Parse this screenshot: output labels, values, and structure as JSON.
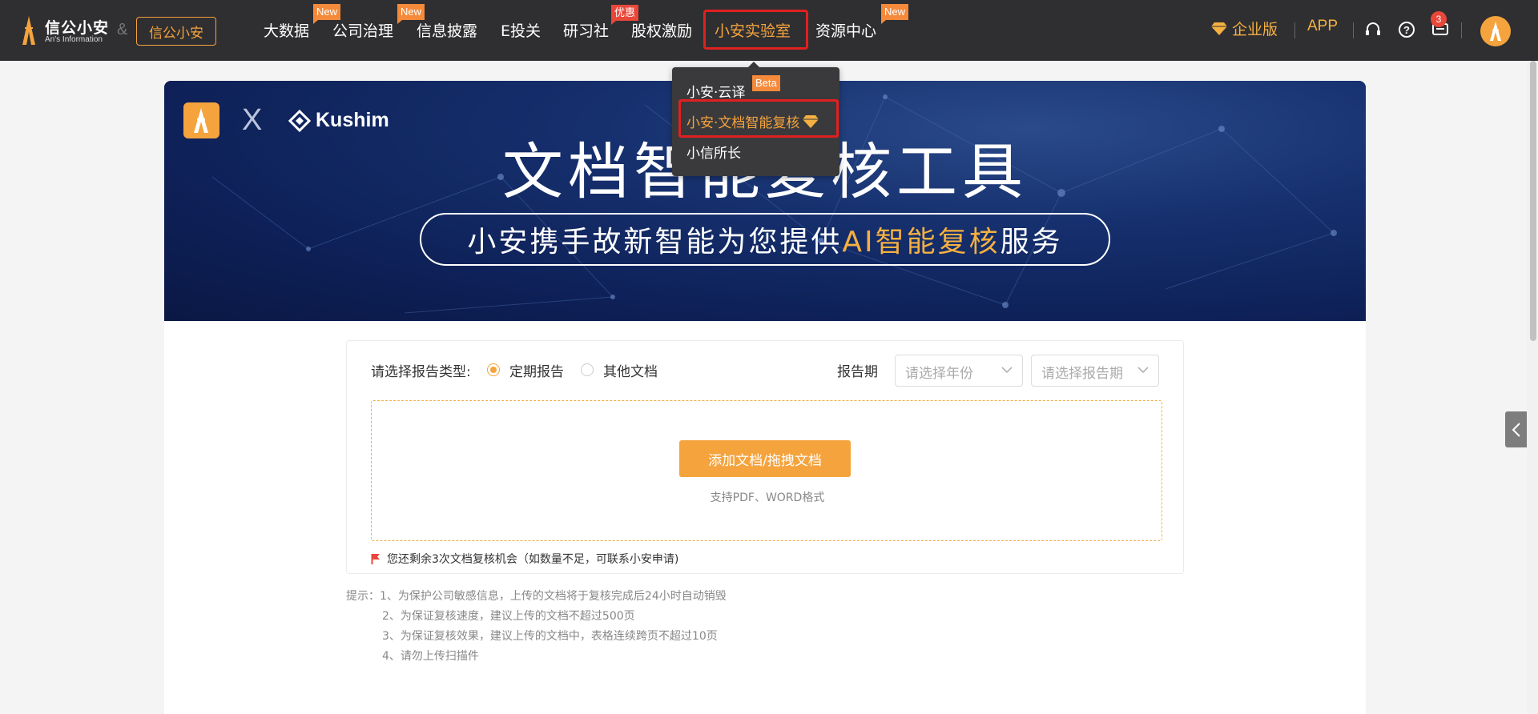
{
  "header": {
    "logo_name": "信公小安",
    "logo_en": "An's Information",
    "amp": "&",
    "partner_label": "信公小安",
    "nav": [
      {
        "label": "大数据",
        "badge": "New"
      },
      {
        "label": "公司治理",
        "badge": "New"
      },
      {
        "label": "信息披露",
        "badge": ""
      },
      {
        "label": "E投关",
        "badge": ""
      },
      {
        "label": "研习社",
        "badge": "优惠"
      },
      {
        "label": "股权激励",
        "badge": ""
      },
      {
        "label": "小安实验室",
        "badge": ""
      },
      {
        "label": "资源中心",
        "badge": "New"
      }
    ],
    "enterprise_label": "企业版",
    "app_label": "APP",
    "notice_count": "3",
    "colors": {
      "accent": "#f5a33d",
      "bar": "#2f2f31",
      "highlight": "#e02020"
    }
  },
  "dropdown": {
    "items": [
      {
        "label": "小安·云译",
        "badge": "Beta"
      },
      {
        "label": "小安·文档智能复核",
        "badge": ""
      },
      {
        "label": "小信所长",
        "badge": ""
      }
    ]
  },
  "banner": {
    "x_label": "X",
    "partner_name": "Kushim",
    "title": "文档智能复核工具",
    "subtitle_pre": "小安携手故新智能为您提供",
    "subtitle_hl": "AI智能复核",
    "subtitle_post": "服务"
  },
  "form": {
    "type_label": "请选择报告类型:",
    "options": [
      "定期报告",
      "其他文档"
    ],
    "selected": "定期报告",
    "period_label": "报告期",
    "year_placeholder": "请选择年份",
    "period_placeholder": "请选择报告期",
    "add_button": "添加文档/拖拽文档",
    "support_text": "支持PDF、WORD格式",
    "remain_text": "您还剩余3次文档复核机会（如数量不足，可联系小安申请)"
  },
  "tips": [
    "提示：1、为保护公司敏感信息，上传的文档将于复核完成后24小时自动销毁",
    "2、为保证复核速度，建议上传的文档不超过500页",
    "3、为保证复核效果，建议上传的文档中，表格连续跨页不超过10页",
    "4、请勿上传扫描件"
  ]
}
